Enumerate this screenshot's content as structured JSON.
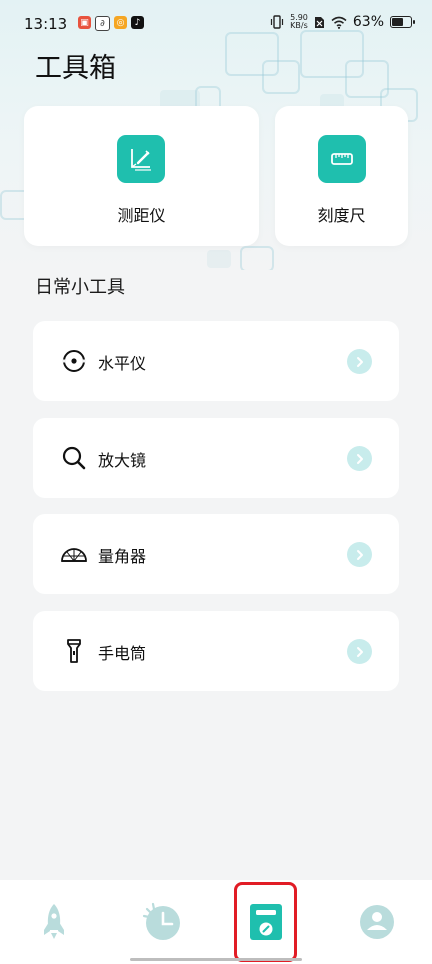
{
  "status_bar": {
    "time": "13:13",
    "net_speed_value": "5.90",
    "net_speed_unit": "KB/s",
    "battery_percent": "63%",
    "battery_level": 0.63
  },
  "header": {
    "title": "工具箱"
  },
  "features": [
    {
      "label": "测距仪",
      "icon": "ruler-measure-icon"
    },
    {
      "label": "刻度尺",
      "icon": "scale-ruler-icon"
    }
  ],
  "section": {
    "title": "日常小工具"
  },
  "tools": [
    {
      "label": "水平仪",
      "icon": "level-icon"
    },
    {
      "label": "放大镜",
      "icon": "magnifier-icon"
    },
    {
      "label": "量角器",
      "icon": "protractor-icon"
    },
    {
      "label": "手电筒",
      "icon": "flashlight-icon"
    }
  ],
  "bottom_nav": {
    "items": [
      {
        "icon": "rocket-icon"
      },
      {
        "icon": "clock-icon"
      },
      {
        "icon": "toolbox-icon",
        "selected": true
      },
      {
        "icon": "profile-icon"
      }
    ]
  },
  "colors": {
    "accent": "#1fbfae",
    "chevron_bg": "#c8ecec",
    "highlight_border": "#e11c25",
    "nav_inactive": "#b9dcdc"
  }
}
